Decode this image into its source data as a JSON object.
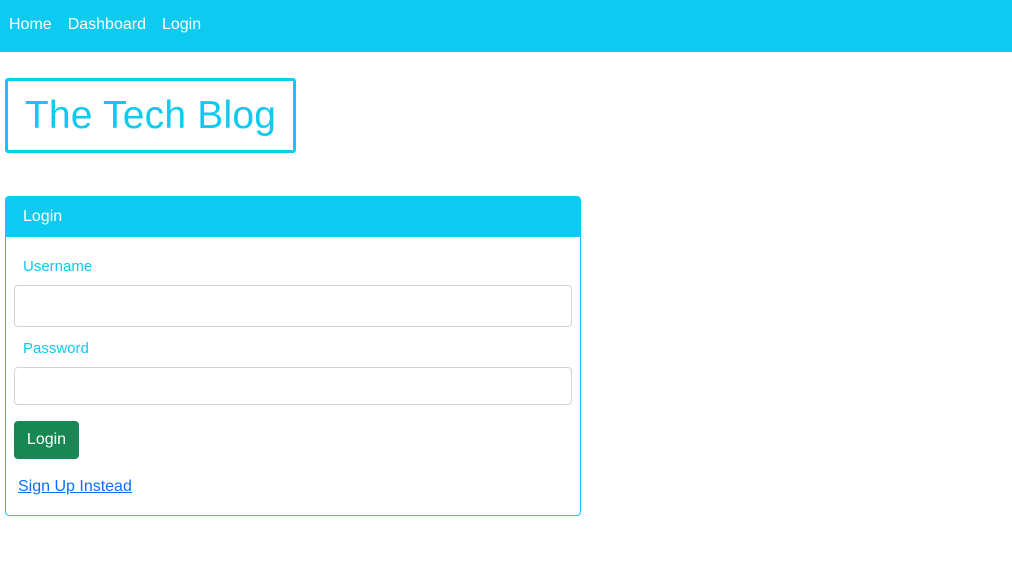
{
  "navbar": {
    "links": [
      {
        "label": "Home"
      },
      {
        "label": "Dashboard"
      },
      {
        "label": "Login"
      }
    ]
  },
  "brand": {
    "title": "The Tech Blog"
  },
  "login_card": {
    "header": "Login",
    "username_label": "Username",
    "username_value": "",
    "password_label": "Password",
    "password_value": "",
    "submit_label": "Login",
    "signup_link": "Sign Up Instead"
  },
  "colors": {
    "accent": "#0dcaf0",
    "button": "#198754",
    "link": "#0d6efd"
  }
}
